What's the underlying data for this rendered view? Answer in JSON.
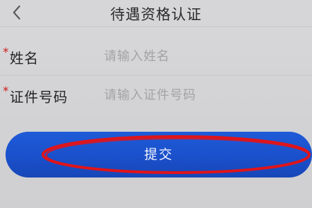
{
  "header": {
    "title": "待遇资格认证",
    "back_icon": "chevron-left-icon"
  },
  "form": {
    "fields": [
      {
        "required_mark": "*",
        "label": "姓名",
        "placeholder": "请输入姓名",
        "value": ""
      },
      {
        "required_mark": "*",
        "label": "证件号码",
        "placeholder": "请输入证件号码",
        "value": ""
      }
    ]
  },
  "submit": {
    "label": "提交",
    "color": "#1a4fc9"
  },
  "annotation": {
    "shape": "oval",
    "color": "#e0141a"
  }
}
